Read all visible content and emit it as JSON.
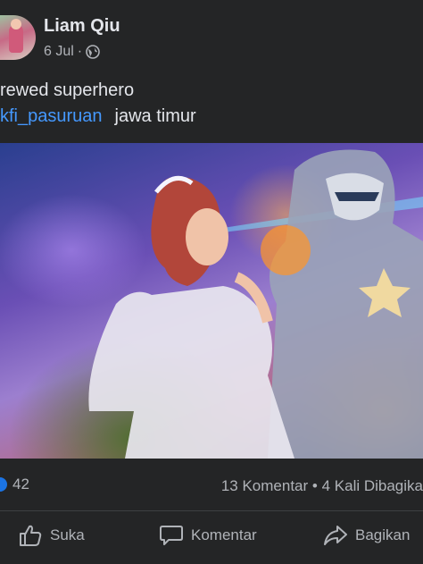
{
  "post": {
    "author": "Liam Qiu",
    "date": "6 Jul",
    "separator": "·",
    "caption_line1": "rewed superhero",
    "hashtag": "kfi_pasuruan",
    "location": "jawa timur"
  },
  "stats": {
    "likes": "42",
    "comments": "13 Komentar",
    "dot": "•",
    "shares": "4 Kali Dibagika"
  },
  "actions": {
    "like": "Suka",
    "comment": "Komentar",
    "share": "Bagikan"
  },
  "colors": {
    "background": "#242526",
    "text": "#e4e6eb",
    "secondary": "#b0b3b8",
    "link": "#4599ff",
    "like_blue": "#1b74e4"
  },
  "icons": [
    "globe-icon",
    "like-icon",
    "thumbs-up-icon",
    "comment-icon",
    "share-icon"
  ]
}
